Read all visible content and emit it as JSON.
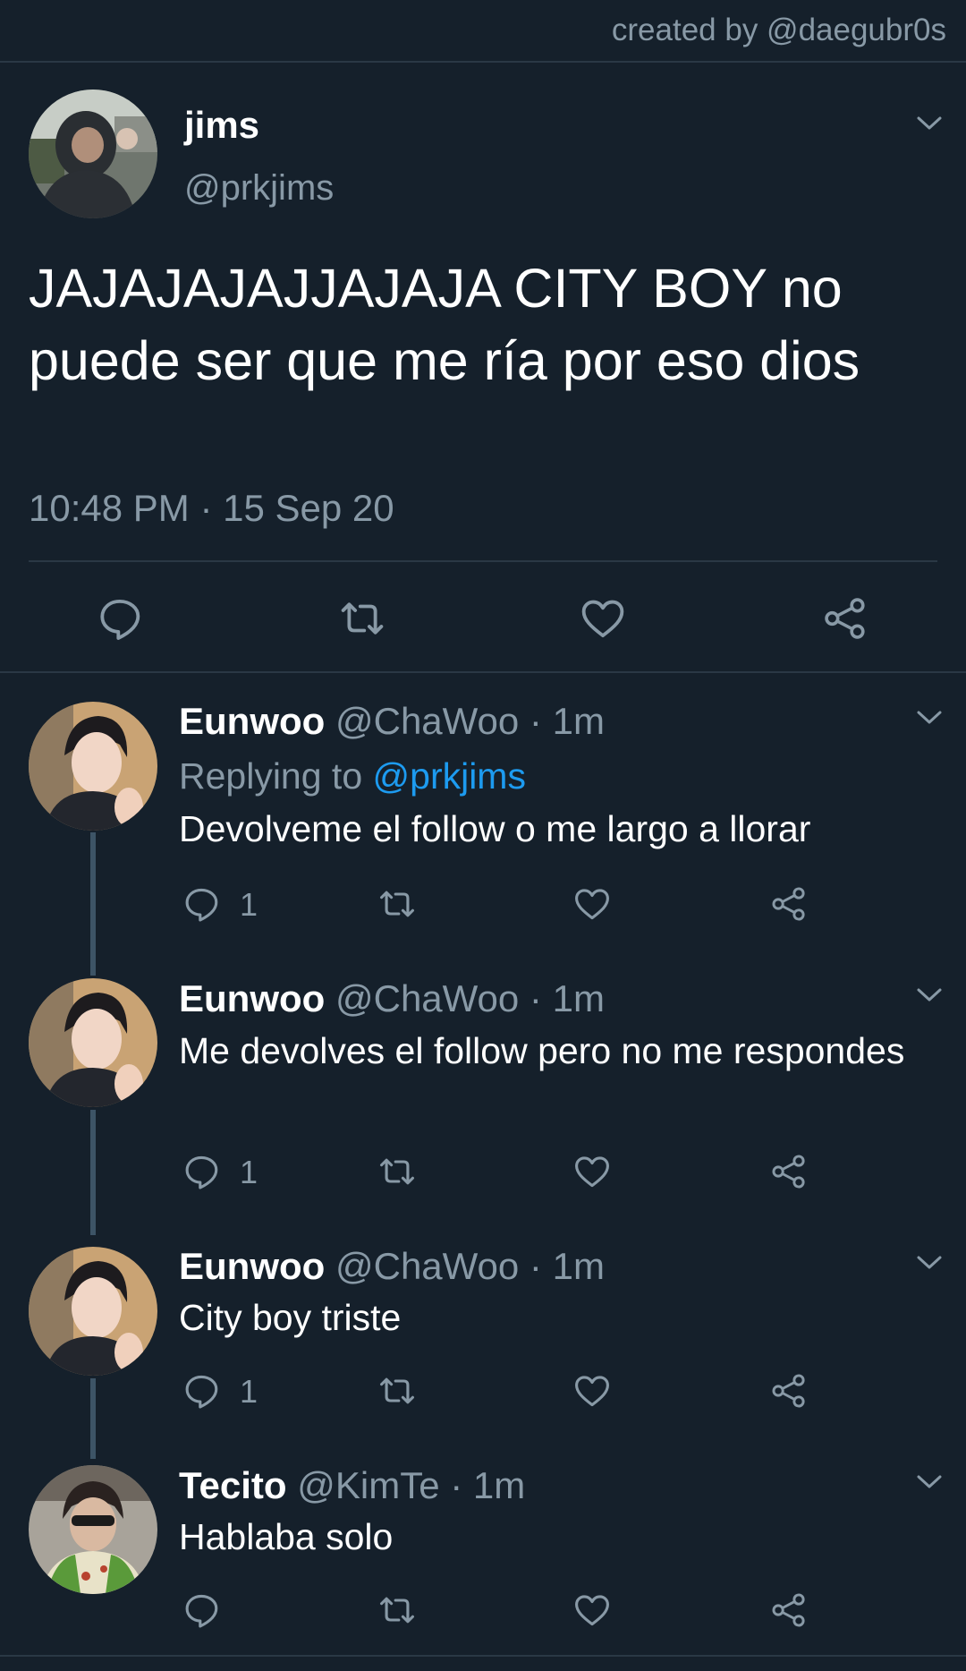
{
  "credit": "created by @daegubr0s",
  "main": {
    "name": "jims",
    "handle": "@prkjims",
    "text": "JAJAJAJAJJAJAJA CITY BOY no puede ser que me ría por eso dios",
    "timestamp": "10:48 PM · 15 Sep 20"
  },
  "replies": [
    {
      "name": "Eunwoo",
      "meta": "@ChaWoo · 1m",
      "replying_prefix": "Replying to ",
      "replying_handle": "@prkjims",
      "text": "Devolveme el follow o me largo a llorar",
      "reply_count": "1"
    },
    {
      "name": "Eunwoo",
      "meta": "@ChaWoo · 1m",
      "text": "Me devolves el follow pero no me respondes",
      "reply_count": "1"
    },
    {
      "name": "Eunwoo",
      "meta": "@ChaWoo · 1m",
      "text": "City boy triste",
      "reply_count": "1"
    },
    {
      "name": "Tecito",
      "meta": "@KimTe · 1m",
      "text": "Hablaba solo",
      "reply_count": ""
    }
  ],
  "icons": {
    "reply": "speech-bubble",
    "retweet": "retweet-arrows",
    "like": "heart",
    "share": "share-nodes",
    "menu": "chevron-down"
  },
  "colors": {
    "background": "#15202b",
    "text": "#ffffff",
    "muted": "#8899a6",
    "link": "#1d9bf0",
    "divider": "#2a3845"
  }
}
